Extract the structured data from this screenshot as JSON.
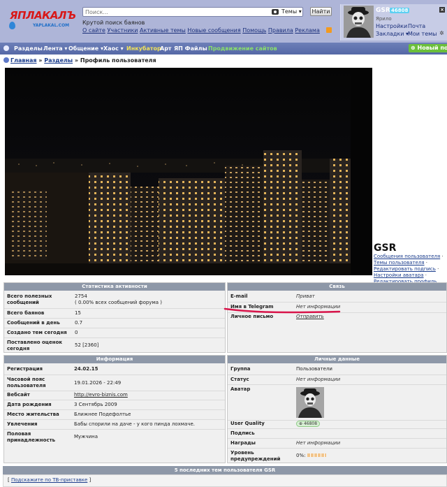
{
  "header": {
    "logo_main": "ЯПЛАКАЛЪ",
    "logo_sub": "YAPLAKAL.COM",
    "search_placeholder": "Поиск...",
    "search_scope": "Темы ▾",
    "search_button": "Найти",
    "slogan": "Крутой поиск баянов",
    "links": [
      "О сайте",
      "Участники",
      "Активные темы",
      "Новые сообщения",
      "Помощь",
      "Правила",
      "Реклама"
    ]
  },
  "user": {
    "name": "GSR",
    "rating": "46808",
    "region": "Ярило",
    "settings": "Настройки",
    "mail": "Почта",
    "bookmarks": "Закладки ▾",
    "my_topics": "Мои темы",
    "close": "×",
    "gear": "✲"
  },
  "nav": {
    "items": [
      "Разделы",
      "Лента ▾",
      "Общение ▾",
      "Хаос ▾",
      "Инкубатор",
      "Арт",
      "ЯП Файлы",
      "Продвижение сайтов"
    ],
    "new_post": "Новый пост"
  },
  "breadcrumb": {
    "home": "Главная",
    "sections": "Разделы",
    "current": "Профиль пользователя"
  },
  "profile": {
    "name": "GSR",
    "links": [
      "Сообщения пользователя",
      "Темы пользователя",
      "Редактировать подпись",
      "Настройки аватара",
      "Редактировать профиль"
    ]
  },
  "stats": {
    "title": "Статистика активности",
    "rows": [
      {
        "k": "Всего полезных сообщений",
        "v": "2754",
        "sub": "( 0.00% всех сообщений форума )"
      },
      {
        "k": "Всего баянов",
        "v": "15"
      },
      {
        "k": "Сообщений в день",
        "v": "0.7"
      },
      {
        "k": "Создано тем сегодня",
        "v": "0"
      },
      {
        "k": "Поставлено оценок сегодня",
        "v": "52 [2360]"
      }
    ]
  },
  "contact": {
    "title": "Связь",
    "rows": [
      {
        "k": "E-mail",
        "v": "Приват"
      },
      {
        "k": "Имя в Telegram",
        "v": "Нет информации"
      },
      {
        "k": "Личное письмо",
        "v": "Отправить"
      }
    ]
  },
  "info": {
    "title": "Информация",
    "rows": [
      {
        "k": "Регистрация",
        "v": "24.02.15"
      },
      {
        "k": "Часовой пояс пользователя",
        "v": "19.01.2026 - 22:49"
      },
      {
        "k": "Вебсайт",
        "v": "http://evro-biznis.com"
      },
      {
        "k": "Дата рождения",
        "v": "3 Сентябрь 2009"
      },
      {
        "k": "Место жительства",
        "v": "Ближнее Подефолтье"
      },
      {
        "k": "Увлечения",
        "v": "Бабы спорили на даче - у кого пинда лохмаче."
      },
      {
        "k": "Половая принадлежность",
        "v": "Мужчина"
      }
    ]
  },
  "personal": {
    "title": "Личные данные",
    "rows": [
      {
        "k": "Группа",
        "v": "Пользователи"
      },
      {
        "k": "Статус",
        "v": "Нет информации"
      },
      {
        "k": "Аватар",
        "v": ""
      },
      {
        "k": "User Quality",
        "v": "46808"
      },
      {
        "k": "Подпись",
        "v": ""
      },
      {
        "k": "Награды",
        "v": "Нет информации"
      },
      {
        "k": "Уровень предупреждений",
        "v": "0%:"
      }
    ]
  },
  "recent": {
    "title": "5 последних тем пользователя GSR",
    "item": "Подскажите по ТВ-приставке"
  }
}
